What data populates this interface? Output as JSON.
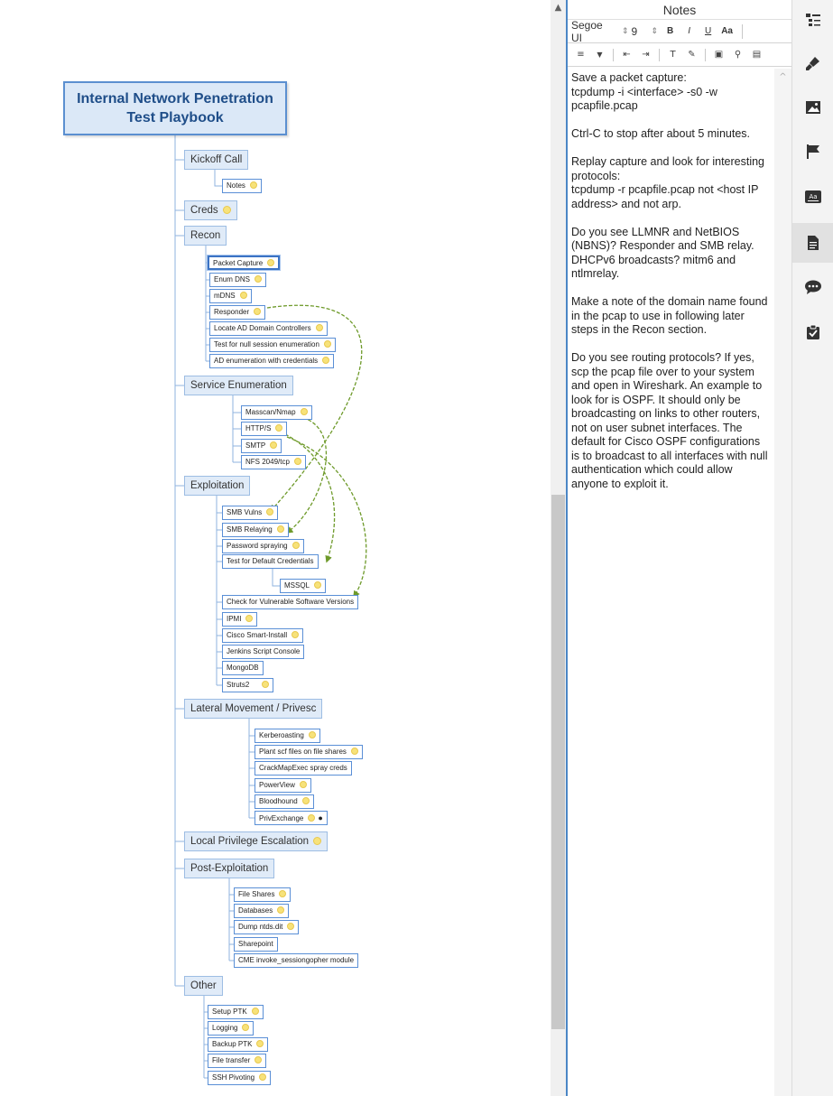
{
  "map": {
    "root_line1": "Internal Network Penetration",
    "root_line2": "Test Playbook",
    "kickoff": "Kickoff Call",
    "kickoff_notes": "Notes",
    "creds": "Creds",
    "recon": {
      "label": "Recon",
      "items": [
        "Packet Capture",
        "Enum DNS",
        "mDNS",
        "Responder",
        "Locate AD Domain Controllers",
        "Test for null session enumeration",
        "AD enumeration with credentials"
      ]
    },
    "service_enum": {
      "label": "Service Enumeration",
      "items": [
        "Masscan/Nmap",
        "HTTP/S",
        "SMTP",
        "NFS 2049/tcp"
      ]
    },
    "exploitation": {
      "label": "Exploitation",
      "items": [
        "SMB Vulns",
        "SMB Relaying",
        "Password spraying",
        "Test for Default Credentials",
        "MSSQL",
        "Check for Vulnerable Software Versions",
        "IPMI",
        "Cisco Smart-Install",
        "Jenkins Script Console",
        "MongoDB",
        "Struts2"
      ]
    },
    "lateral": {
      "label": "Lateral Movement / Privesc",
      "items": [
        "Kerberoasting",
        "Plant scf files on file shares",
        "CrackMapExec spray creds",
        "PowerView",
        "Bloodhound",
        "PrivExchange"
      ]
    },
    "local_priv": "Local Privilege Escalation",
    "post_exploit": {
      "label": "Post-Exploitation",
      "items": [
        "File Shares",
        "Databases",
        "Dump ntds.dit",
        "Sharepoint",
        "CME invoke_sessiongopher module"
      ]
    },
    "other": {
      "label": "Other",
      "items": [
        "Setup PTK",
        "Logging",
        "Backup PTK",
        "File transfer",
        "SSH Pivoting"
      ]
    }
  },
  "notes_panel": {
    "title": "Notes",
    "font_name": "Segoe UI",
    "font_size": "9",
    "bold": "B",
    "italic": "I",
    "underline": "U",
    "text_case": "Aa",
    "paragraphs": [
      "Save a packet capture:",
      "tcpdump -i <interface> -s0 -w pcapfile.pcap",
      "Ctrl-C to stop after about 5 minutes.",
      "Replay capture and look for interesting protocols:",
      "tcpdump -r pcapfile.pcap not <host IP address> and not arp.",
      "Do you see LLMNR and NetBIOS (NBNS)? Responder and SMB relay. DHCPv6 broadcasts? mitm6 and ntlmrelay.",
      "Make a note of the domain name found in the pcap to use in following later steps in the Recon section.",
      "Do you see routing protocols? If yes, scp the pcap file over to your system and open in Wireshark. An example to look for is OSPF. It should only be broadcasting on links to other routers, not on user subnet interfaces. The default for Cisco OSPF configurations is to broadcast to all interfaces with null authentication which could allow anyone to exploit it."
    ]
  },
  "colors": {
    "accent": "#4b86c6",
    "node_border": "#5a8fd6",
    "relation_arrow": "#6e9a2a",
    "star": "#f7e27a"
  },
  "icons": {
    "sidebar": [
      "outline-icon",
      "format-brush-icon",
      "image-icon",
      "flag-icon",
      "text-style-icon",
      "notes-icon",
      "comment-icon",
      "task-icon"
    ]
  }
}
